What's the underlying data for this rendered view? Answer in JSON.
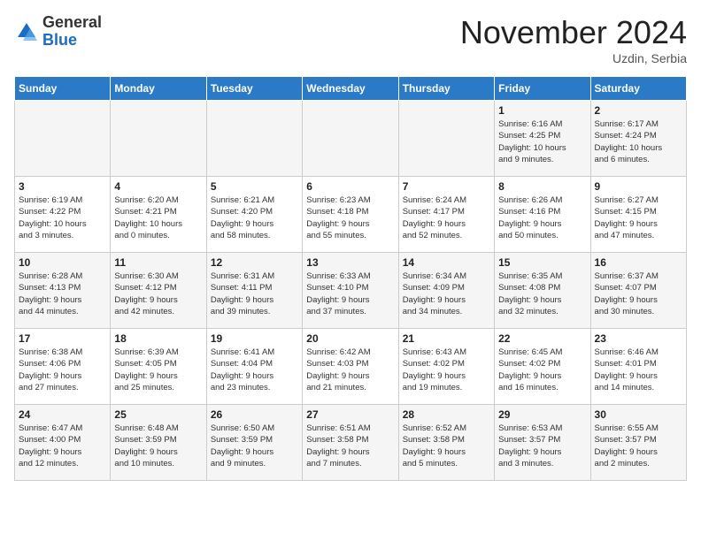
{
  "logo": {
    "general": "General",
    "blue": "Blue"
  },
  "header": {
    "month": "November 2024",
    "location": "Uzdin, Serbia"
  },
  "weekdays": [
    "Sunday",
    "Monday",
    "Tuesday",
    "Wednesday",
    "Thursday",
    "Friday",
    "Saturday"
  ],
  "weeks": [
    [
      {
        "day": "",
        "info": ""
      },
      {
        "day": "",
        "info": ""
      },
      {
        "day": "",
        "info": ""
      },
      {
        "day": "",
        "info": ""
      },
      {
        "day": "",
        "info": ""
      },
      {
        "day": "1",
        "info": "Sunrise: 6:16 AM\nSunset: 4:25 PM\nDaylight: 10 hours\nand 9 minutes."
      },
      {
        "day": "2",
        "info": "Sunrise: 6:17 AM\nSunset: 4:24 PM\nDaylight: 10 hours\nand 6 minutes."
      }
    ],
    [
      {
        "day": "3",
        "info": "Sunrise: 6:19 AM\nSunset: 4:22 PM\nDaylight: 10 hours\nand 3 minutes."
      },
      {
        "day": "4",
        "info": "Sunrise: 6:20 AM\nSunset: 4:21 PM\nDaylight: 10 hours\nand 0 minutes."
      },
      {
        "day": "5",
        "info": "Sunrise: 6:21 AM\nSunset: 4:20 PM\nDaylight: 9 hours\nand 58 minutes."
      },
      {
        "day": "6",
        "info": "Sunrise: 6:23 AM\nSunset: 4:18 PM\nDaylight: 9 hours\nand 55 minutes."
      },
      {
        "day": "7",
        "info": "Sunrise: 6:24 AM\nSunset: 4:17 PM\nDaylight: 9 hours\nand 52 minutes."
      },
      {
        "day": "8",
        "info": "Sunrise: 6:26 AM\nSunset: 4:16 PM\nDaylight: 9 hours\nand 50 minutes."
      },
      {
        "day": "9",
        "info": "Sunrise: 6:27 AM\nSunset: 4:15 PM\nDaylight: 9 hours\nand 47 minutes."
      }
    ],
    [
      {
        "day": "10",
        "info": "Sunrise: 6:28 AM\nSunset: 4:13 PM\nDaylight: 9 hours\nand 44 minutes."
      },
      {
        "day": "11",
        "info": "Sunrise: 6:30 AM\nSunset: 4:12 PM\nDaylight: 9 hours\nand 42 minutes."
      },
      {
        "day": "12",
        "info": "Sunrise: 6:31 AM\nSunset: 4:11 PM\nDaylight: 9 hours\nand 39 minutes."
      },
      {
        "day": "13",
        "info": "Sunrise: 6:33 AM\nSunset: 4:10 PM\nDaylight: 9 hours\nand 37 minutes."
      },
      {
        "day": "14",
        "info": "Sunrise: 6:34 AM\nSunset: 4:09 PM\nDaylight: 9 hours\nand 34 minutes."
      },
      {
        "day": "15",
        "info": "Sunrise: 6:35 AM\nSunset: 4:08 PM\nDaylight: 9 hours\nand 32 minutes."
      },
      {
        "day": "16",
        "info": "Sunrise: 6:37 AM\nSunset: 4:07 PM\nDaylight: 9 hours\nand 30 minutes."
      }
    ],
    [
      {
        "day": "17",
        "info": "Sunrise: 6:38 AM\nSunset: 4:06 PM\nDaylight: 9 hours\nand 27 minutes."
      },
      {
        "day": "18",
        "info": "Sunrise: 6:39 AM\nSunset: 4:05 PM\nDaylight: 9 hours\nand 25 minutes."
      },
      {
        "day": "19",
        "info": "Sunrise: 6:41 AM\nSunset: 4:04 PM\nDaylight: 9 hours\nand 23 minutes."
      },
      {
        "day": "20",
        "info": "Sunrise: 6:42 AM\nSunset: 4:03 PM\nDaylight: 9 hours\nand 21 minutes."
      },
      {
        "day": "21",
        "info": "Sunrise: 6:43 AM\nSunset: 4:02 PM\nDaylight: 9 hours\nand 19 minutes."
      },
      {
        "day": "22",
        "info": "Sunrise: 6:45 AM\nSunset: 4:02 PM\nDaylight: 9 hours\nand 16 minutes."
      },
      {
        "day": "23",
        "info": "Sunrise: 6:46 AM\nSunset: 4:01 PM\nDaylight: 9 hours\nand 14 minutes."
      }
    ],
    [
      {
        "day": "24",
        "info": "Sunrise: 6:47 AM\nSunset: 4:00 PM\nDaylight: 9 hours\nand 12 minutes."
      },
      {
        "day": "25",
        "info": "Sunrise: 6:48 AM\nSunset: 3:59 PM\nDaylight: 9 hours\nand 10 minutes."
      },
      {
        "day": "26",
        "info": "Sunrise: 6:50 AM\nSunset: 3:59 PM\nDaylight: 9 hours\nand 9 minutes."
      },
      {
        "day": "27",
        "info": "Sunrise: 6:51 AM\nSunset: 3:58 PM\nDaylight: 9 hours\nand 7 minutes."
      },
      {
        "day": "28",
        "info": "Sunrise: 6:52 AM\nSunset: 3:58 PM\nDaylight: 9 hours\nand 5 minutes."
      },
      {
        "day": "29",
        "info": "Sunrise: 6:53 AM\nSunset: 3:57 PM\nDaylight: 9 hours\nand 3 minutes."
      },
      {
        "day": "30",
        "info": "Sunrise: 6:55 AM\nSunset: 3:57 PM\nDaylight: 9 hours\nand 2 minutes."
      }
    ]
  ]
}
